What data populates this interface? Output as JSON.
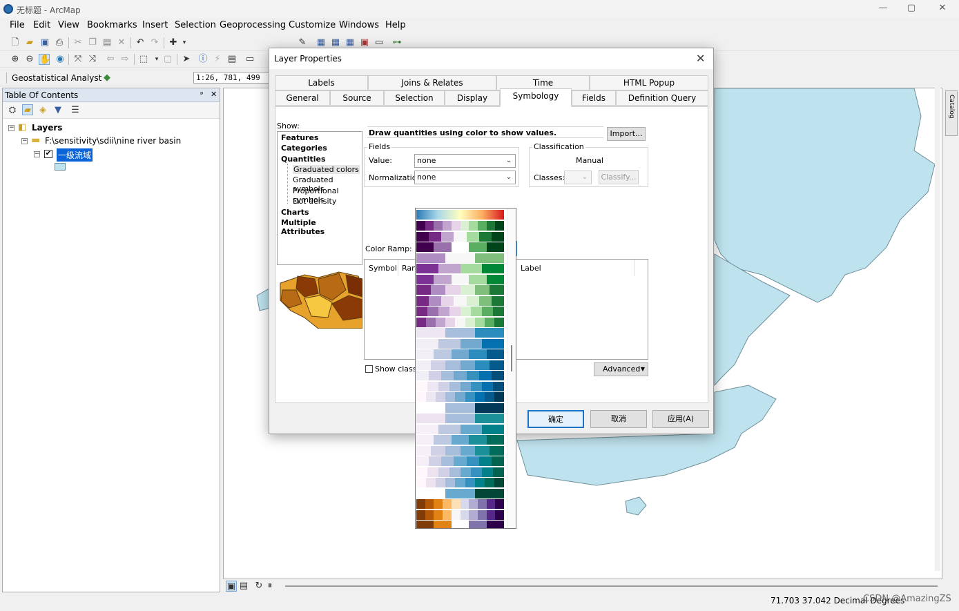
{
  "window": {
    "title": "无标题 - ArcMap",
    "minimize": "—",
    "maximize": "▢",
    "close": "✕"
  },
  "menu": [
    "File",
    "Edit",
    "View",
    "Bookmarks",
    "Insert",
    "Selection",
    "Geoprocessing",
    "Customize",
    "Windows",
    "Help"
  ],
  "toolbar": {
    "scale": "1:26, 781, 499",
    "geostat_label": "Geostatistical Analyst ▾"
  },
  "toc": {
    "title": "Table Of Contents",
    "pin": "ᵖ",
    "close": "✕",
    "layers_label": "Layers",
    "folder_label": "F:\\sensitivity\\sdii\\nine river basin",
    "layer_label": "一级流域"
  },
  "dialog": {
    "title": "Layer Properties",
    "close": "✕",
    "tabs_row1": [
      "Labels",
      "Joins & Relates",
      "Time",
      "HTML Popup"
    ],
    "tabs_row2": [
      "General",
      "Source",
      "Selection",
      "Display",
      "Symbology",
      "Fields",
      "Definition Query"
    ],
    "active_tab": "Symbology",
    "show_label": "Show:",
    "show_items": {
      "features": "Features",
      "categories": "Categories",
      "quantities": "Quantities",
      "graduated_colors": "Graduated colors",
      "graduated_symbols": "Graduated symbols",
      "proportional_symbols": "Proportional symbols",
      "dot_density": "Dot density",
      "charts": "Charts",
      "multiple_attributes": "Multiple Attributes"
    },
    "description": "Draw quantities using color to show values.",
    "import_button": "Import...",
    "fields_group": "Fields",
    "value_label": "Value:",
    "value_selected": "none",
    "normalization_label": "Normalization:",
    "normalization_selected": "none",
    "classification_group": "Classification",
    "classification_method": "Manual",
    "classes_label": "Classes:",
    "classify_button": "Classify...",
    "color_ramp_label": "Color Ramp:",
    "table_headers": {
      "symbol": "Symbol",
      "range": "Ran",
      "label": "Label"
    },
    "show_class_ranges": "Show class ra",
    "advanced_button": "Advanced",
    "ok_button": "确定",
    "cancel_button": "取消",
    "apply_button": "应用(A)"
  },
  "status": {
    "coords": "71.703  37.042 Decimal Degrees",
    "watermark": "CSDN @AmazingZS"
  },
  "catalog_tab": "Catalog",
  "colors": {
    "map_fill": "#bfe3ee",
    "map_stroke": "#6f8f9a",
    "selected_layer_bg": "#0a64d8",
    "ramp_preview": [
      "#2c7bb6",
      "#abd9e9",
      "#ffffbf",
      "#fdae61",
      "#d7191c"
    ]
  },
  "color_ramps": [
    [
      "#40004b",
      "#762a83",
      "#9970ab",
      "#c2a5cf",
      "#e7d4e8",
      "#d9f0d3",
      "#a6dba0",
      "#5aae61",
      "#1b7837",
      "#00441b"
    ],
    [
      "#40004b",
      "#762a83",
      "#c2a5cf",
      "#f7f7f7",
      "#a6dba0",
      "#1b7837",
      "#00441b"
    ],
    [
      "#40004b",
      "#9970ab",
      "#ffffff",
      "#5aae61",
      "#00441b"
    ],
    [
      "#af8dc3",
      "#f7f7f7",
      "#7fbf7b"
    ],
    [
      "#7b3294",
      "#c2a5cf",
      "#a6dba0",
      "#008837"
    ],
    [
      "#7b3294",
      "#c2a5cf",
      "#f7f7f7",
      "#a6dba0",
      "#008837"
    ],
    [
      "#762a83",
      "#af8dc3",
      "#e7d4e8",
      "#d9f0d3",
      "#7fbf7b",
      "#1b7837"
    ],
    [
      "#762a83",
      "#af8dc3",
      "#e7d4e8",
      "#f7f7f7",
      "#d9f0d3",
      "#7fbf7b",
      "#1b7837"
    ],
    [
      "#762a83",
      "#9970ab",
      "#c2a5cf",
      "#e7d4e8",
      "#d9f0d3",
      "#a6dba0",
      "#5aae61",
      "#1b7837"
    ],
    [
      "#762a83",
      "#9970ab",
      "#c2a5cf",
      "#e7d4e8",
      "#f7f7f7",
      "#d9f0d3",
      "#a6dba0",
      "#5aae61",
      "#1b7837"
    ],
    [
      "#ece7f2",
      "#a6bddb",
      "#2b8cbe"
    ],
    [
      "#f1eef6",
      "#bdc9e1",
      "#74a9cf",
      "#0570b0"
    ],
    [
      "#f1eef6",
      "#bdc9e1",
      "#74a9cf",
      "#2b8cbe",
      "#045a8d"
    ],
    [
      "#f1eef6",
      "#d0d1e6",
      "#a6bddb",
      "#74a9cf",
      "#2b8cbe",
      "#045a8d"
    ],
    [
      "#f1eef6",
      "#d0d1e6",
      "#a6bddb",
      "#74a9cf",
      "#3690c0",
      "#0570b0",
      "#034e7b"
    ],
    [
      "#fff7fb",
      "#ece7f2",
      "#d0d1e6",
      "#a6bddb",
      "#74a9cf",
      "#3690c0",
      "#0570b0",
      "#034e7b"
    ],
    [
      "#fff7fb",
      "#ece7f2",
      "#d0d1e6",
      "#a6bddb",
      "#74a9cf",
      "#3690c0",
      "#0570b0",
      "#045a8d",
      "#023858"
    ],
    [
      "#ffffff",
      "#a6bddb",
      "#023858"
    ],
    [
      "#ece2f0",
      "#a6bddb",
      "#1c9099"
    ],
    [
      "#f6eff7",
      "#bdc9e1",
      "#67a9cf",
      "#02818a"
    ],
    [
      "#f6eff7",
      "#bdc9e1",
      "#67a9cf",
      "#1c9099",
      "#016c59"
    ],
    [
      "#f6eff7",
      "#d0d1e6",
      "#a6bddb",
      "#67a9cf",
      "#1c9099",
      "#016c59"
    ],
    [
      "#f6eff7",
      "#d0d1e6",
      "#a6bddb",
      "#67a9cf",
      "#3690c0",
      "#02818a",
      "#016450"
    ],
    [
      "#fff7fb",
      "#ece2f0",
      "#d0d1e6",
      "#a6bddb",
      "#67a9cf",
      "#3690c0",
      "#02818a",
      "#016450"
    ],
    [
      "#fff7fb",
      "#ece2f0",
      "#d0d1e6",
      "#a6bddb",
      "#67a9cf",
      "#3690c0",
      "#02818a",
      "#016c59",
      "#014636"
    ],
    [
      "#ffffff",
      "#67a9cf",
      "#014636"
    ],
    [
      "#7f3b08",
      "#b35806",
      "#e08214",
      "#fdb863",
      "#fee0b6",
      "#d8daeb",
      "#b2abd2",
      "#8073ac",
      "#542788",
      "#2d004b"
    ],
    [
      "#7f3b08",
      "#b35806",
      "#e08214",
      "#fdb863",
      "#f7f7f7",
      "#d8daeb",
      "#b2abd2",
      "#8073ac",
      "#542788",
      "#2d004b"
    ],
    [
      "#7f3b08",
      "#e08214",
      "#ffffff",
      "#8073ac",
      "#2d004b"
    ]
  ]
}
